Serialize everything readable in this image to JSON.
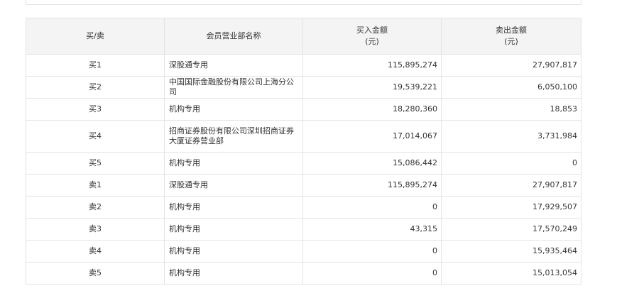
{
  "table": {
    "headers": {
      "side": "买/卖",
      "name": "会员营业部名称",
      "buy_line1": "买入金额",
      "buy_line2": "(元)",
      "sell_line1": "卖出金额",
      "sell_line2": "(元)"
    },
    "rows": [
      {
        "side": "买1",
        "name": "深股通专用",
        "buy": "115,895,274",
        "sell": "27,907,817"
      },
      {
        "side": "买2",
        "name": "中国国际金融股份有限公司上海分公司",
        "buy": "19,539,221",
        "sell": "6,050,100"
      },
      {
        "side": "买3",
        "name": "机构专用",
        "buy": "18,280,360",
        "sell": "18,853"
      },
      {
        "side": "买4",
        "name": "招商证券股份有限公司深圳招商证券大厦证券营业部",
        "buy": "17,014,067",
        "sell": "3,731,984"
      },
      {
        "side": "买5",
        "name": "机构专用",
        "buy": "15,086,442",
        "sell": "0"
      },
      {
        "side": "卖1",
        "name": "深股通专用",
        "buy": "115,895,274",
        "sell": "27,907,817"
      },
      {
        "side": "卖2",
        "name": "机构专用",
        "buy": "0",
        "sell": "17,929,507"
      },
      {
        "side": "卖3",
        "name": "机构专用",
        "buy": "43,315",
        "sell": "17,570,249"
      },
      {
        "side": "卖4",
        "name": "机构专用",
        "buy": "0",
        "sell": "15,935,464"
      },
      {
        "side": "卖5",
        "name": "机构专用",
        "buy": "0",
        "sell": "15,013,054"
      }
    ]
  }
}
